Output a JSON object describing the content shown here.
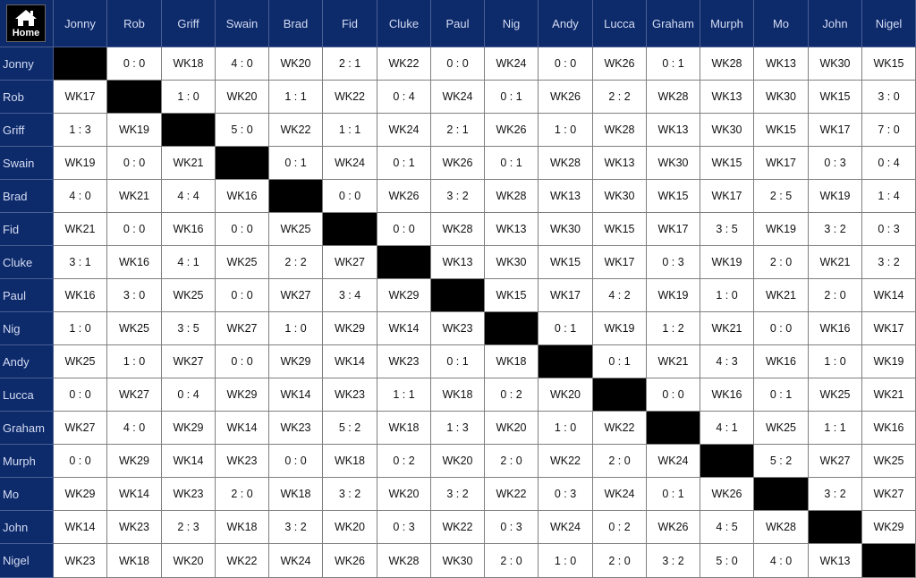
{
  "home": {
    "label": "Home"
  },
  "players": [
    "Jonny",
    "Rob",
    "Griff",
    "Swain",
    "Brad",
    "Fid",
    "Cluke",
    "Paul",
    "Nig",
    "Andy",
    "Lucca",
    "Graham",
    "Murph",
    "Mo",
    "John",
    "Nigel"
  ],
  "rows": [
    [
      "",
      "0 : 0",
      "WK18",
      "4 : 0",
      "WK20",
      "2 : 1",
      "WK22",
      "0 : 0",
      "WK24",
      "0 : 0",
      "WK26",
      "0 : 1",
      "WK28",
      "WK13",
      "WK30",
      "WK15"
    ],
    [
      "WK17",
      "",
      "1 : 0",
      "WK20",
      "1 : 1",
      "WK22",
      "0 : 4",
      "WK24",
      "0 : 1",
      "WK26",
      "2 : 2",
      "WK28",
      "WK13",
      "WK30",
      "WK15",
      "3 : 0"
    ],
    [
      "1 : 3",
      "WK19",
      "",
      "5 : 0",
      "WK22",
      "1 : 1",
      "WK24",
      "2 : 1",
      "WK26",
      "1 : 0",
      "WK28",
      "WK13",
      "WK30",
      "WK15",
      "WK17",
      "7 : 0"
    ],
    [
      "WK19",
      "0 : 0",
      "WK21",
      "",
      "0 : 1",
      "WK24",
      "0 : 1",
      "WK26",
      "0 : 1",
      "WK28",
      "WK13",
      "WK30",
      "WK15",
      "WK17",
      "0 : 3",
      "0 : 4"
    ],
    [
      "4 : 0",
      "WK21",
      "4 : 4",
      "WK16",
      "",
      "0 : 0",
      "WK26",
      "3 : 2",
      "WK28",
      "WK13",
      "WK30",
      "WK15",
      "WK17",
      "2 : 5",
      "WK19",
      "1 : 4"
    ],
    [
      "WK21",
      "0 : 0",
      "WK16",
      "0 : 0",
      "WK25",
      "",
      "0 : 0",
      "WK28",
      "WK13",
      "WK30",
      "WK15",
      "WK17",
      "3 : 5",
      "WK19",
      "3 : 2",
      "0 : 3"
    ],
    [
      "3 : 1",
      "WK16",
      "4 : 1",
      "WK25",
      "2 : 2",
      "WK27",
      "",
      "WK13",
      "WK30",
      "WK15",
      "WK17",
      "0 : 3",
      "WK19",
      "2 : 0",
      "WK21",
      "3 : 2"
    ],
    [
      "WK16",
      "3 : 0",
      "WK25",
      "0 : 0",
      "WK27",
      "3 : 4",
      "WK29",
      "",
      "WK15",
      "WK17",
      "4 : 2",
      "WK19",
      "1 : 0",
      "WK21",
      "2 : 0",
      "WK14"
    ],
    [
      "1 : 0",
      "WK25",
      "3 : 5",
      "WK27",
      "1 : 0",
      "WK29",
      "WK14",
      "WK23",
      "",
      "0 : 1",
      "WK19",
      "1 : 2",
      "WK21",
      "0 : 0",
      "WK16",
      "WK17"
    ],
    [
      "WK25",
      "1 : 0",
      "WK27",
      "0 : 0",
      "WK29",
      "WK14",
      "WK23",
      "0 : 1",
      "WK18",
      "",
      "0 : 1",
      "WK21",
      "4 : 3",
      "WK16",
      "1 : 0",
      "WK19"
    ],
    [
      "0 : 0",
      "WK27",
      "0 : 4",
      "WK29",
      "WK14",
      "WK23",
      "1 : 1",
      "WK18",
      "0 : 2",
      "WK20",
      "",
      "0 : 0",
      "WK16",
      "0 : 1",
      "WK25",
      "WK21"
    ],
    [
      "WK27",
      "4 : 0",
      "WK29",
      "WK14",
      "WK23",
      "5 : 2",
      "WK18",
      "1 : 3",
      "WK20",
      "1 : 0",
      "WK22",
      "",
      "4 : 1",
      "WK25",
      "1 : 1",
      "WK16"
    ],
    [
      "0 : 0",
      "WK29",
      "WK14",
      "WK23",
      "0 : 0",
      "WK18",
      "0 : 2",
      "WK20",
      "2 : 0",
      "WK22",
      "2 : 0",
      "WK24",
      "",
      "5 : 2",
      "WK27",
      "WK25"
    ],
    [
      "WK29",
      "WK14",
      "WK23",
      "2 : 0",
      "WK18",
      "3 : 2",
      "WK20",
      "3 : 2",
      "WK22",
      "0 : 3",
      "WK24",
      "0 : 1",
      "WK26",
      "",
      "3 : 2",
      "WK27"
    ],
    [
      "WK14",
      "WK23",
      "2 : 3",
      "WK18",
      "3 : 2",
      "WK20",
      "0 : 3",
      "WK22",
      "0 : 3",
      "WK24",
      "0 : 2",
      "WK26",
      "4 : 5",
      "WK28",
      "",
      "WK29"
    ],
    [
      "WK23",
      "WK18",
      "WK20",
      "WK22",
      "WK24",
      "WK26",
      "WK28",
      "WK30",
      "2 : 0",
      "1 : 0",
      "2 : 0",
      "3 : 2",
      "5 : 0",
      "4 : 0",
      "WK13",
      ""
    ]
  ],
  "colors": {
    "header_bg": "#0d2a6b",
    "header_text": "#d4dcf2",
    "diagonal": "#000000",
    "cell_bg": "#ffffff"
  },
  "icons": {
    "home": "house-icon"
  }
}
